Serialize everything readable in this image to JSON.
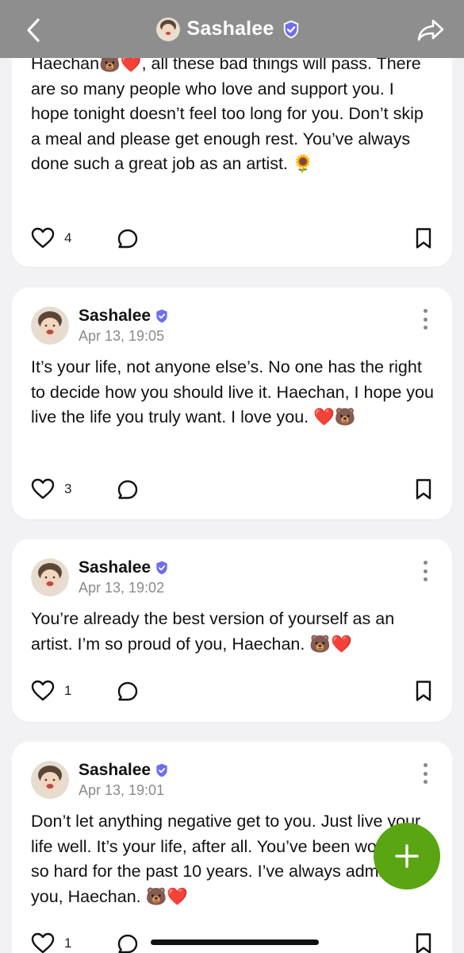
{
  "header": {
    "title": "Sashalee"
  },
  "posts": [
    {
      "text": "Haechan🐻❤️, all these bad things will pass. There are so many people who love and support you. I hope tonight doesn’t feel too long for you. Don’t skip a meal and please get enough rest. You’ve always done such a great job as an artist. 🌻",
      "likes": "4"
    },
    {
      "author": "Sashalee",
      "date": "Apr 13, 19:05",
      "text": "It’s your life, not anyone else’s. No one has the right to decide how you should live it. Haechan, I hope you live the life you truly want. I love you. ❤️🐻",
      "likes": "3"
    },
    {
      "author": "Sashalee",
      "date": "Apr 13, 19:02",
      "text": "You’re already the best version of yourself as an artist. I’m so proud of you, Haechan. 🐻❤️",
      "likes": "1"
    },
    {
      "author": "Sashalee",
      "date": "Apr 13, 19:01",
      "text": "Don’t let anything negative get to you. Just live your life well. It’s your life, after all. You’ve been working so hard for the past 10 years. I’ve always admired you, Haechan. 🐻❤️",
      "likes": "1"
    }
  ],
  "icons": {
    "back": "chevron-left-icon",
    "share": "share-arrow-icon",
    "verified": "verified-badge-icon",
    "like": "heart-outline-icon",
    "comment": "speech-bubble-icon",
    "bookmark": "bookmark-icon",
    "more": "more-vertical-icon",
    "fab": "plus-icon"
  },
  "colors": {
    "header_bg": "#8e8e8e",
    "accent_green": "#5aa512",
    "verified_blue": "#6e6ef0",
    "page_bg": "#f2f2f4"
  }
}
